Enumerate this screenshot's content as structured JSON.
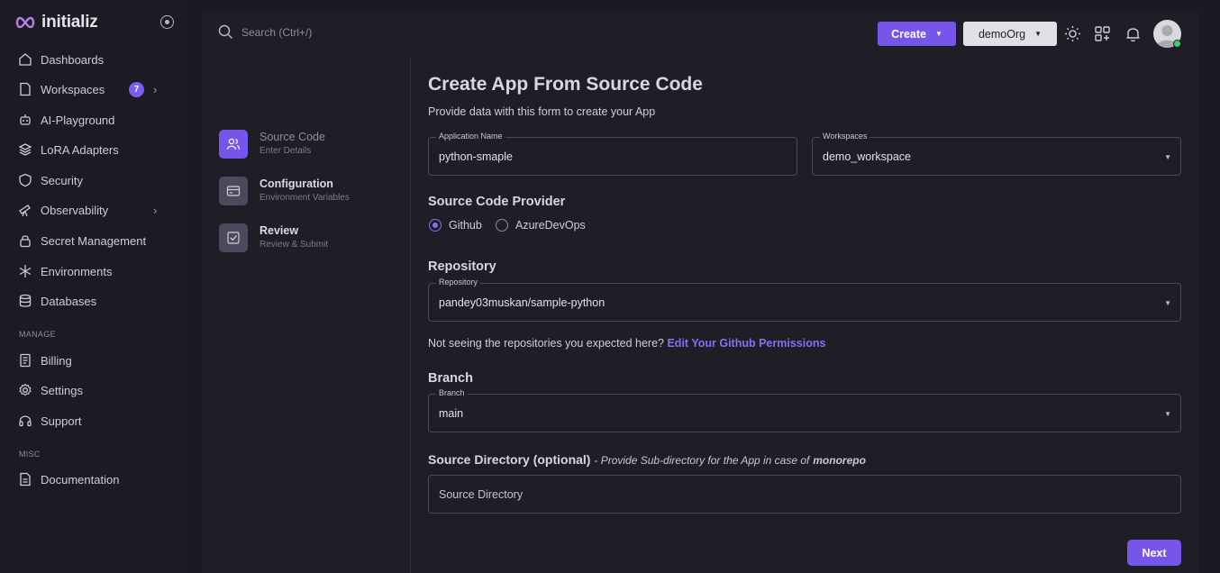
{
  "app": {
    "name": "initializ"
  },
  "sidebar": {
    "items": [
      {
        "label": "Dashboards",
        "icon": "home-icon"
      },
      {
        "label": "Workspaces",
        "icon": "file-icon",
        "badge": "7"
      },
      {
        "label": "AI-Playground",
        "icon": "robot-icon"
      },
      {
        "label": "LoRA Adapters",
        "icon": "layers-icon"
      },
      {
        "label": "Security",
        "icon": "shield-icon"
      },
      {
        "label": "Observability",
        "icon": "telescope-icon"
      },
      {
        "label": "Secret Management",
        "icon": "lock-icon"
      },
      {
        "label": "Environments",
        "icon": "snowflake-icon"
      },
      {
        "label": "Databases",
        "icon": "database-icon"
      }
    ],
    "manage_label": "MANAGE",
    "manage_items": [
      {
        "label": "Billing",
        "icon": "receipt-icon"
      },
      {
        "label": "Settings",
        "icon": "gear-icon"
      },
      {
        "label": "Support",
        "icon": "headset-icon"
      }
    ],
    "misc_label": "MISC",
    "misc_items": [
      {
        "label": "Documentation",
        "icon": "document-icon"
      }
    ]
  },
  "topbar": {
    "search_placeholder": "Search (Ctrl+/)",
    "create_label": "Create",
    "org_label": "demoOrg"
  },
  "steps": [
    {
      "title": "Source Code",
      "subtitle": "Enter Details",
      "icon": "users-icon",
      "active": true
    },
    {
      "title": "Configuration",
      "subtitle": "Environment Variables",
      "icon": "card-icon"
    },
    {
      "title": "Review",
      "subtitle": "Review & Submit",
      "icon": "check-square-icon"
    }
  ],
  "form": {
    "title": "Create App From Source Code",
    "subtitle": "Provide data with this form to create your App",
    "app_name_label": "Application Name",
    "app_name_value": "python-smaple",
    "workspaces_label": "Workspaces",
    "workspaces_value": "demo_workspace",
    "provider_heading": "Source Code Provider",
    "provider_options": [
      "Github",
      "AzureDevOps"
    ],
    "provider_selected": "Github",
    "repository_heading": "Repository",
    "repository_label": "Repository",
    "repository_value": "pandey03muskan/sample-python",
    "repo_hint": "Not seeing the repositories you expected here?",
    "repo_hint_link": "Edit Your Github Permissions",
    "branch_heading": "Branch",
    "branch_label": "Branch",
    "branch_value": "main",
    "source_dir_heading": "Source Directory (optional)",
    "source_dir_note_prefix": "- Provide Sub-directory for the App in case of",
    "source_dir_note_bold": "monorepo",
    "source_dir_placeholder": "Source Directory",
    "next_label": "Next"
  },
  "colors": {
    "accent": "#7656ea",
    "sidebar_bg": "#1c1b23",
    "main_bg": "#1f1e27",
    "link": "#8a6cf7"
  }
}
